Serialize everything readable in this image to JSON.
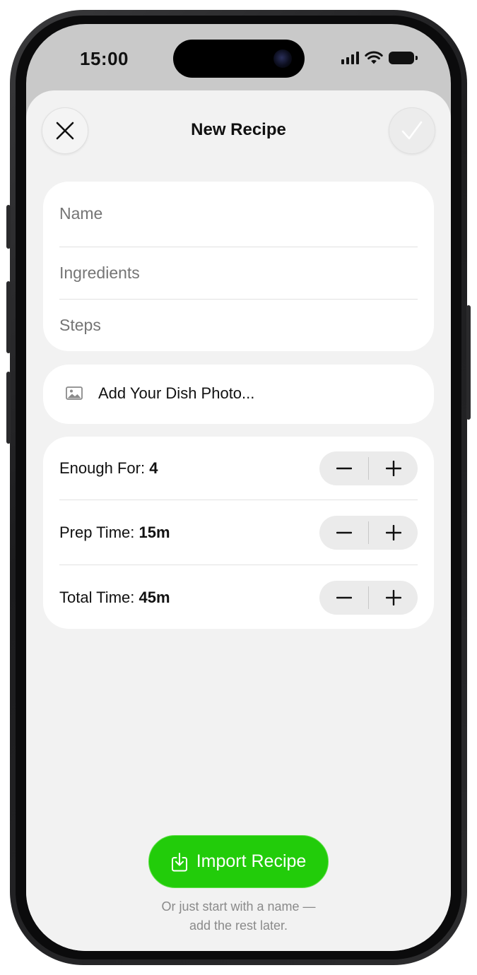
{
  "status_bar": {
    "time": "15:00"
  },
  "header": {
    "title": "New Recipe"
  },
  "form": {
    "name_placeholder": "Name",
    "ingredients_placeholder": "Ingredients",
    "steps_placeholder": "Steps"
  },
  "photo": {
    "label": "Add Your Dish Photo..."
  },
  "steppers": [
    {
      "label": "Enough For:",
      "value": "4"
    },
    {
      "label": "Prep Time:",
      "value": "15m"
    },
    {
      "label": "Total Time:",
      "value": "45m"
    }
  ],
  "import": {
    "label": "Import Recipe"
  },
  "hint": {
    "line1": "Or just start with a name —",
    "line2": "add the rest later."
  },
  "colors": {
    "accent_green": "#22cc0a",
    "sheet_background": "#f2f2f2",
    "card_background": "#ffffff"
  }
}
